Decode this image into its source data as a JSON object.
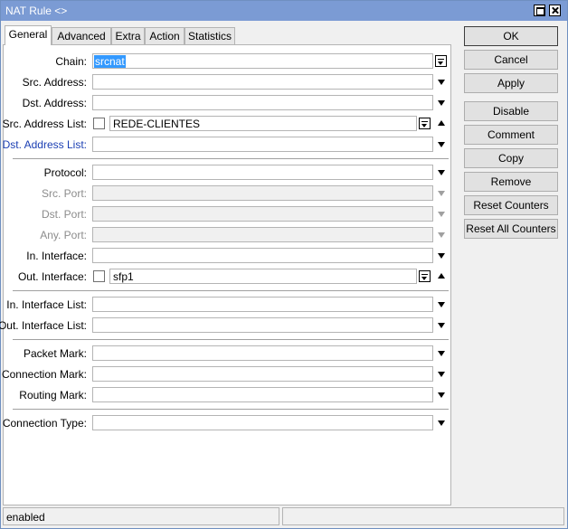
{
  "window": {
    "title": "NAT Rule <>"
  },
  "tabs": [
    {
      "label": "General",
      "active": true
    },
    {
      "label": "Advanced"
    },
    {
      "label": "Extra"
    },
    {
      "label": "Action"
    },
    {
      "label": "Statistics"
    }
  ],
  "general": {
    "chain": {
      "label": "Chain:",
      "value": "srcnat"
    },
    "src_address": {
      "label": "Src. Address:",
      "value": ""
    },
    "dst_address": {
      "label": "Dst. Address:",
      "value": ""
    },
    "src_address_list": {
      "label": "Src. Address List:",
      "value": "REDE-CLIENTES"
    },
    "dst_address_list": {
      "label": "Dst. Address List:",
      "value": ""
    },
    "protocol": {
      "label": "Protocol:",
      "value": ""
    },
    "src_port": {
      "label": "Src. Port:",
      "value": ""
    },
    "dst_port": {
      "label": "Dst. Port:",
      "value": ""
    },
    "any_port": {
      "label": "Any. Port:",
      "value": ""
    },
    "in_interface": {
      "label": "In. Interface:",
      "value": ""
    },
    "out_interface": {
      "label": "Out. Interface:",
      "value": "sfp1"
    },
    "in_interface_list": {
      "label": "In. Interface List:",
      "value": ""
    },
    "out_interface_list": {
      "label": "Out. Interface List:",
      "value": ""
    },
    "packet_mark": {
      "label": "Packet Mark:",
      "value": ""
    },
    "connection_mark": {
      "label": "Connection Mark:",
      "value": ""
    },
    "routing_mark": {
      "label": "Routing Mark:",
      "value": ""
    },
    "connection_type": {
      "label": "Connection Type:",
      "value": ""
    }
  },
  "buttons": {
    "ok": "OK",
    "cancel": "Cancel",
    "apply": "Apply",
    "disable": "Disable",
    "comment": "Comment",
    "copy": "Copy",
    "remove": "Remove",
    "reset_counters": "Reset Counters",
    "reset_all_counters": "Reset All Counters"
  },
  "status": {
    "text": "enabled"
  },
  "colors": {
    "titlebar": "#7b9bd4",
    "selection": "#3399ff",
    "link_label": "#1b3fb3"
  }
}
